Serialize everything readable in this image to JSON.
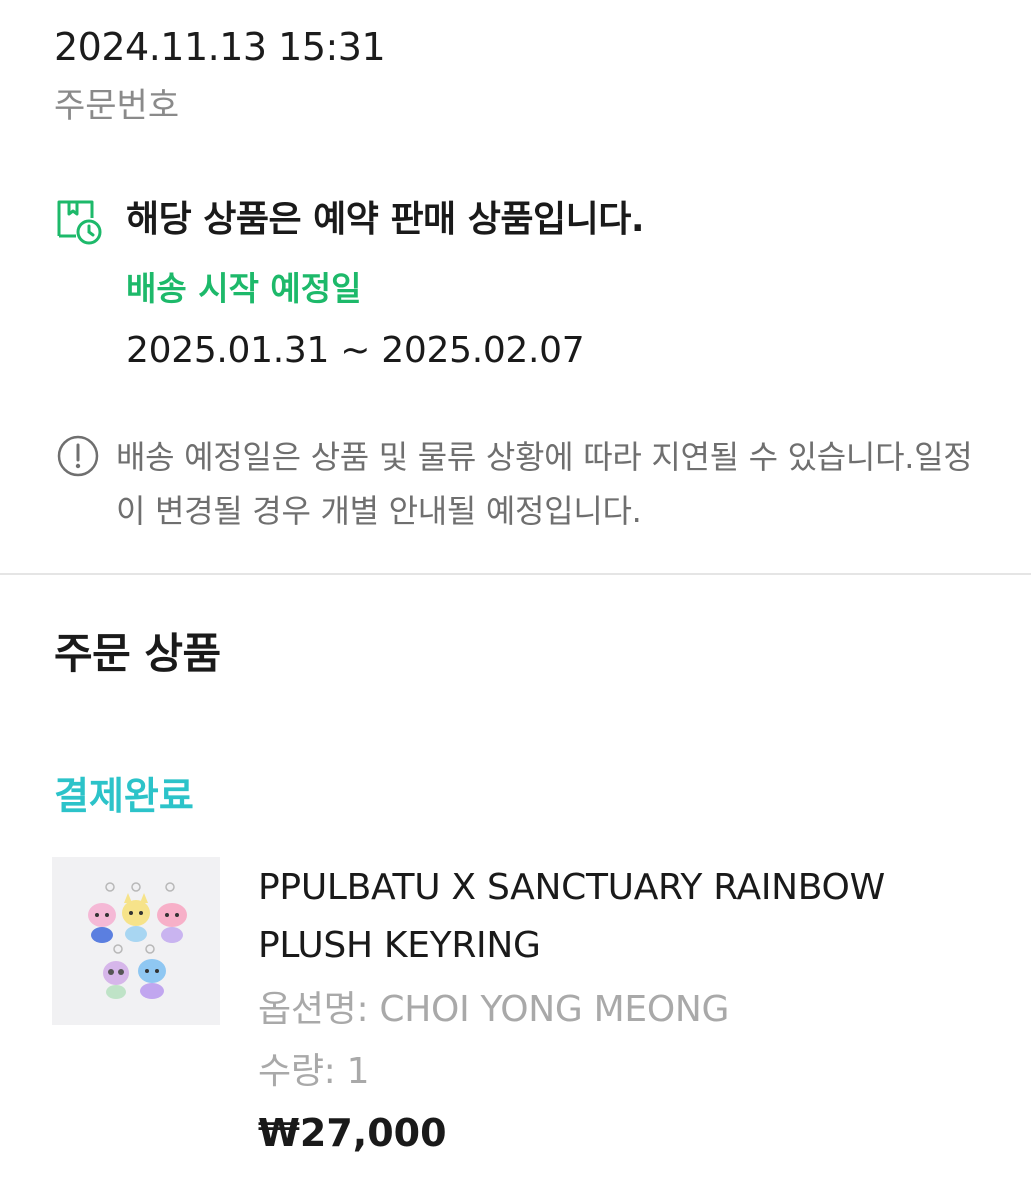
{
  "order": {
    "datetime": "2024.11.13 15:31",
    "number_label": "주문번호"
  },
  "preorder": {
    "icon": "package-clock-icon",
    "title": "해당 상품은 예약 판매 상품입니다.",
    "ship_start_label": "배송 시작 예정일",
    "ship_dates": "2025.01.31 ~ 2025.02.07"
  },
  "notice": {
    "icon": "info-circle-icon",
    "text": "배송 예정일은 상품 및 물류 상황에 따라 지연될 수 있습니다.일정이 변경될 경우 개별 안내될 예정입니다."
  },
  "section": {
    "title": "주문 상품"
  },
  "item": {
    "status": "결제완료",
    "name": "PPULBATU X SANCTUARY RAINBOW PLUSH KEYRING",
    "option": "옵션명: CHOI YONG MEONG",
    "quantity": "수량: 1",
    "price": "₩27,000"
  },
  "colors": {
    "brand_green": "#1db96a",
    "status_teal": "#2cc3c9",
    "muted_text": "#8a8a8a"
  }
}
